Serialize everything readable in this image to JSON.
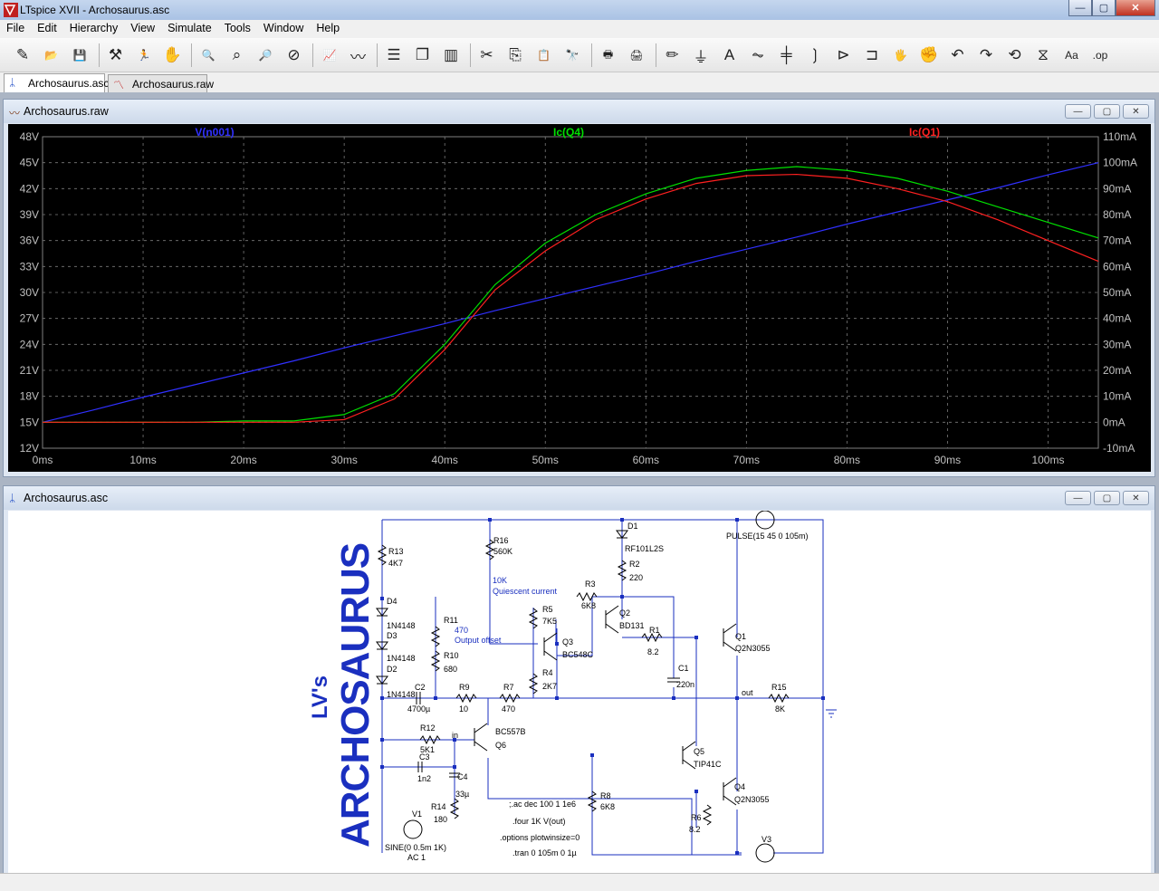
{
  "window": {
    "title": "LTspice XVII - Archosaurus.asc",
    "controls": {
      "minimize": "—",
      "maximize": "▢",
      "close": "✕"
    }
  },
  "menu": [
    "File",
    "Edit",
    "Hierarchy",
    "View",
    "Simulate",
    "Tools",
    "Window",
    "Help"
  ],
  "toolbar": {
    "icons": [
      "new-schematic-icon",
      "open-icon",
      "save-icon",
      "control-panel-icon",
      "run-icon",
      "halt-icon",
      "zoom-in-icon",
      "zoom-fit-icon",
      "zoom-out-icon",
      "cancel-zoom-icon",
      "autorange-icon",
      "fft-icon",
      "tile-horizontal-icon",
      "cascade-icon",
      "tile-vertical-icon",
      "cut-icon",
      "copy-icon",
      "paste-icon",
      "find-icon",
      "print-icon",
      "print-setup-icon",
      "pencil-icon",
      "ground-icon",
      "label-icon",
      "resistor-icon",
      "capacitor-icon",
      "inductor-icon",
      "diode-icon",
      "component-icon",
      "move-icon",
      "drag-icon",
      "undo-icon",
      "redo-icon",
      "rotate-icon",
      "mirror-icon",
      "text-icon",
      "spice-directive-icon"
    ],
    "glyphs": [
      "✎",
      "📂",
      "💾",
      "⚒",
      "🏃",
      "✋",
      "🔍",
      "⌕",
      "🔎",
      "⊘",
      "📈",
      "〰",
      "☰",
      "❐",
      "▥",
      "✂",
      "⎘",
      "📋",
      "🔭",
      "🖶",
      "🖨",
      "✏",
      "⏚",
      "A",
      "⏦",
      "╪",
      "❳",
      "⊳",
      "⊐",
      "🖐",
      "✊",
      "↶",
      "↷",
      "⟲",
      "⧖",
      "Aa",
      ".op"
    ]
  },
  "tabs": [
    {
      "label": "Archosaurus.asc",
      "active": true
    },
    {
      "label": "Archosaurus.raw",
      "active": false
    }
  ],
  "plot_window": {
    "title": "Archosaurus.raw",
    "controls": {
      "minimize": "—",
      "maximize": "▢",
      "close": "✕"
    }
  },
  "schematic_window": {
    "title": "Archosaurus.asc",
    "controls": {
      "minimize": "—",
      "maximize": "▢",
      "close": "✕"
    }
  },
  "chart_data": {
    "type": "line",
    "x": [
      0,
      5,
      10,
      15,
      20,
      25,
      30,
      35,
      40,
      45,
      50,
      55,
      60,
      65,
      70,
      75,
      80,
      85,
      90,
      95,
      100,
      105
    ],
    "xticks": [
      "0ms",
      "10ms",
      "20ms",
      "30ms",
      "40ms",
      "50ms",
      "60ms",
      "70ms",
      "80ms",
      "90ms",
      "100ms"
    ],
    "xlim": [
      0,
      105
    ],
    "left_axis": {
      "ticks": [
        "48V",
        "45V",
        "42V",
        "39V",
        "36V",
        "33V",
        "30V",
        "27V",
        "24V",
        "21V",
        "18V",
        "15V",
        "12V"
      ],
      "lim": [
        12,
        48
      ]
    },
    "right_axis": {
      "ticks": [
        "110mA",
        "100mA",
        "90mA",
        "80mA",
        "70mA",
        "60mA",
        "50mA",
        "40mA",
        "30mA",
        "20mA",
        "10mA",
        "0mA",
        "-10mA"
      ],
      "lim": [
        -10,
        110
      ]
    },
    "grid": true,
    "series": [
      {
        "name": "V(n001)",
        "color": "#3030ff",
        "axis": "left",
        "values": [
          15,
          16.4,
          17.9,
          19.3,
          20.7,
          22.1,
          23.6,
          25.0,
          26.4,
          27.9,
          29.3,
          30.7,
          32.1,
          33.6,
          35.0,
          36.4,
          37.9,
          39.3,
          40.7,
          42.1,
          43.6,
          45.0
        ]
      },
      {
        "name": "Ic(Q4)",
        "color": "#00e000",
        "axis": "right",
        "values": [
          0,
          0,
          0,
          0,
          0.5,
          0.5,
          3,
          11,
          30,
          53,
          69,
          80,
          88,
          94,
          97,
          98.5,
          97,
          94,
          89,
          83,
          77,
          71
        ]
      },
      {
        "name": "Ic(Q1)",
        "color": "#ff2020",
        "axis": "right",
        "values": [
          0,
          0,
          0,
          0,
          0,
          0,
          1,
          9,
          28,
          51,
          66,
          78,
          86,
          92,
          95,
          95.5,
          94,
          90,
          85,
          78,
          70,
          62
        ]
      }
    ]
  },
  "schematic": {
    "logo_big": "ARCHOSAURUS",
    "logo_small": "LV's",
    "labels": [
      "R13",
      "4K7",
      "D4",
      "1N4148",
      "D3",
      "1N4148",
      "D2",
      "1N4148",
      "R11",
      "470",
      "Output offset",
      "R10",
      "680",
      "C2",
      "4700µ",
      "R9",
      "10",
      "R7",
      "470",
      "R16",
      "560K",
      "10K",
      "Quiescent current",
      "R5",
      "7K5",
      "R4",
      "2K7",
      "R3",
      "6K8",
      "Q3",
      "BC548C",
      "D1",
      "RF101L2S",
      "R2",
      "220",
      "Q2",
      "BD131",
      "R1",
      "8.2",
      "C1",
      "220n",
      "Q1",
      "Q2N3055",
      "PULSE(15 45 0 105m)",
      "out",
      "R15",
      "8K",
      "R12",
      "5K1",
      "in",
      "BC557B",
      "Q6",
      "C3",
      "1n2",
      "C4",
      "33µ",
      "R14",
      "180",
      "V1",
      "SINE(0 0.5m 1K)",
      "AC 1",
      "Q5",
      "TIP41C",
      "R8",
      "6K8",
      "R6",
      "8.2",
      "Q4",
      "Q2N3055",
      "V3"
    ],
    "directives": [
      ";.ac dec 100 1 1e6",
      ".four 1K V(out)",
      ".options plotwinsize=0",
      ".tran 0 105m 0 1µ"
    ]
  }
}
